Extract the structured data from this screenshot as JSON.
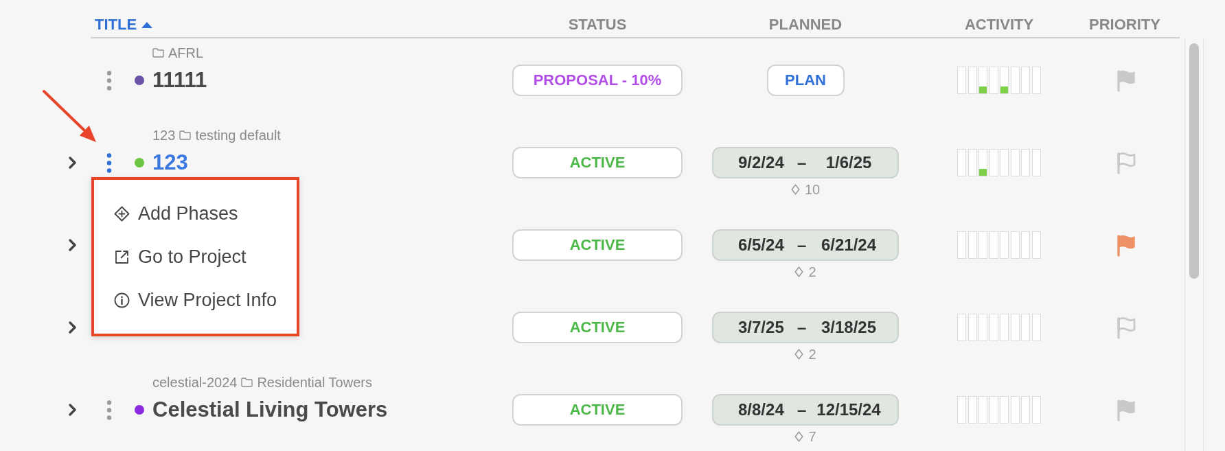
{
  "columns": [
    {
      "label": "TITLE",
      "sorted": true
    },
    {
      "label": "STATUS",
      "sorted": false
    },
    {
      "label": "PLANNED",
      "sorted": false
    },
    {
      "label": "ACTIVITY",
      "sorted": false
    },
    {
      "label": "PRIORITY",
      "sorted": false
    }
  ],
  "rows": [
    {
      "expandable": false,
      "folder": "AFRL",
      "menu_open": false,
      "color": "#6a55a9",
      "title": "11111",
      "status": {
        "kind": "proposal",
        "label": "PROPOSAL - 10%"
      },
      "planned": {
        "kind": "plan",
        "label": "PLAN"
      },
      "activity": [
        {
          "active": false
        },
        {
          "active": false
        },
        {
          "active": true
        },
        {
          "active": false
        },
        {
          "active": true
        },
        {
          "active": false
        },
        {
          "active": false
        },
        {
          "active": false
        }
      ],
      "priority": {
        "kind": "filled",
        "color": "#c9c9c9"
      }
    },
    {
      "expandable": true,
      "code": "123",
      "folder": "testing default",
      "menu_open": true,
      "color": "#6cc644",
      "title": "123",
      "status": {
        "kind": "active",
        "label": "ACTIVE"
      },
      "planned": {
        "kind": "dates",
        "start": "9/2/24",
        "separator": "–",
        "end": "1/6/25",
        "milestones": "10"
      },
      "activity": [
        {
          "active": false
        },
        {
          "active": false
        },
        {
          "active": true
        },
        {
          "active": false
        },
        {
          "active": false
        },
        {
          "active": false
        },
        {
          "active": false
        },
        {
          "active": false
        }
      ],
      "priority": {
        "kind": "outline",
        "color": "#c9c9c9"
      }
    },
    {
      "expandable": true,
      "status": {
        "kind": "active",
        "label": "ACTIVE"
      },
      "planned": {
        "kind": "dates",
        "start": "6/5/24",
        "separator": "–",
        "end": "6/21/24",
        "milestones": "2"
      },
      "activity": [
        {
          "active": false
        },
        {
          "active": false
        },
        {
          "active": false
        },
        {
          "active": false
        },
        {
          "active": false
        },
        {
          "active": false
        },
        {
          "active": false
        },
        {
          "active": false
        }
      ],
      "priority": {
        "kind": "filled",
        "color": "#ee9166"
      }
    },
    {
      "expandable": true,
      "status": {
        "kind": "active",
        "label": "ACTIVE"
      },
      "planned": {
        "kind": "dates",
        "start": "3/7/25",
        "separator": "–",
        "end": "3/18/25",
        "milestones": "2"
      },
      "activity": [
        {
          "active": false
        },
        {
          "active": false
        },
        {
          "active": false
        },
        {
          "active": false
        },
        {
          "active": false
        },
        {
          "active": false
        },
        {
          "active": false
        },
        {
          "active": false
        }
      ],
      "priority": {
        "kind": "outline",
        "color": "#c9c9c9"
      }
    },
    {
      "expandable": true,
      "code": "celestial-2024",
      "folder": "Residential Towers",
      "menu_open": false,
      "color": "#8a2be2",
      "title": "Celestial Living Towers",
      "status": {
        "kind": "active",
        "label": "ACTIVE"
      },
      "planned": {
        "kind": "dates",
        "start": "8/8/24",
        "separator": "–",
        "end": "12/15/24",
        "milestones": "7"
      },
      "activity": [
        {
          "active": false
        },
        {
          "active": false
        },
        {
          "active": false
        },
        {
          "active": false
        },
        {
          "active": false
        },
        {
          "active": false
        },
        {
          "active": false
        },
        {
          "active": false
        }
      ],
      "priority": {
        "kind": "filled",
        "color": "#c9c9c9"
      }
    }
  ],
  "menu": {
    "highlighted": true,
    "items": [
      {
        "kind": "add",
        "label": "Add Phases"
      },
      {
        "kind": "open",
        "label": "Go to Project"
      },
      {
        "kind": "info",
        "label": "View Project Info"
      }
    ]
  },
  "pointer_arrow": true
}
